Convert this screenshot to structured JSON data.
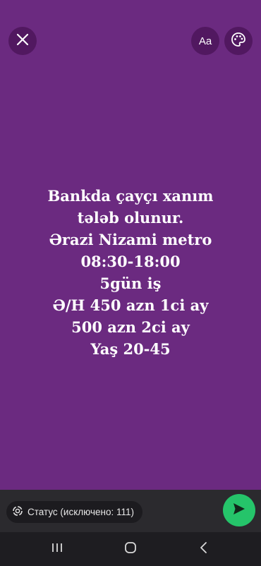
{
  "header": {
    "close_icon": "close-icon",
    "font_label": "Aa",
    "palette_icon": "palette-icon"
  },
  "status": {
    "background_color": "#6b2a80",
    "lines": [
      "Bankda çayçı xanım",
      "tələb olunur.",
      "Ərazi Nizami metro",
      "08:30-18:00",
      "5gün iş",
      "Ə/H 450 azn 1ci ay",
      "500 azn 2ci ay",
      "Yaş 20-45"
    ]
  },
  "footer": {
    "audience_label": "Статус (исключено: 111)",
    "audience_icon": "status-ring-icon",
    "send_icon": "send-icon",
    "send_color": "#25c46a"
  },
  "navigation": {
    "recents_icon": "recents-icon",
    "home_icon": "home-icon",
    "back_icon": "back-icon"
  }
}
